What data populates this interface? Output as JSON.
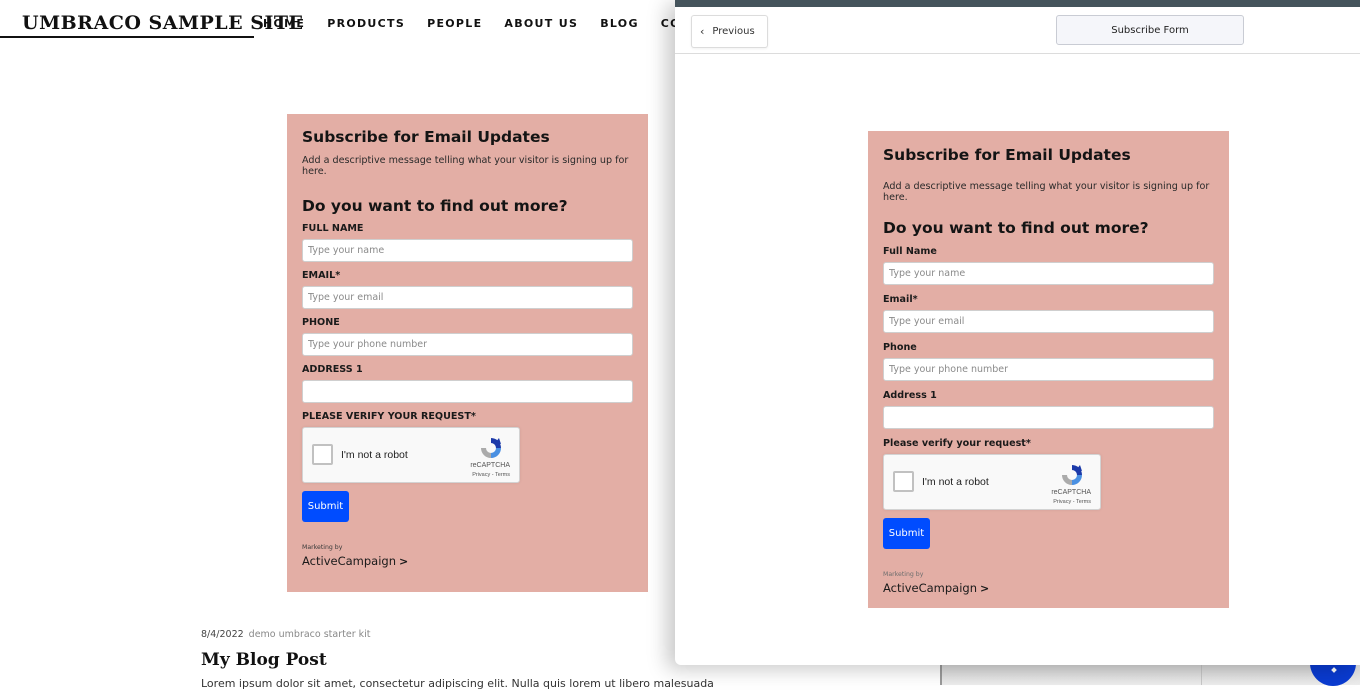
{
  "site": {
    "logo": "UMBRACO SAMPLE SITE",
    "nav": [
      "HOME",
      "PRODUCTS",
      "PEOPLE",
      "ABOUT US",
      "BLOG",
      "CONTACT"
    ],
    "blog": {
      "date": "8/4/2022",
      "tag": "demo umbraco starter kit",
      "title": "My Blog Post",
      "excerpt": "Lorem ipsum dolor sit amet, consectetur adipiscing elit. Nulla quis lorem ut libero malesuada"
    }
  },
  "form_live": {
    "title": "Subscribe for Email Updates",
    "description": "Add a descriptive message telling what your visitor is signing up for here.",
    "heading": "Do you want to find out more?",
    "fields": [
      {
        "label": "FULL NAME",
        "placeholder": "Type your name",
        "value": ""
      },
      {
        "label": "EMAIL*",
        "placeholder": "Type your email",
        "value": ""
      },
      {
        "label": "PHONE",
        "placeholder": "Type your phone number",
        "value": ""
      },
      {
        "label": "ADDRESS 1",
        "placeholder": "",
        "value": ""
      }
    ],
    "verify_label": "PLEASE VERIFY YOUR REQUEST*",
    "captcha": {
      "text": "I'm not a robot",
      "brand": "reCAPTCHA",
      "links": "Privacy - Terms",
      "checked": false
    },
    "submit": "Submit",
    "marketing_by": "Marketing by",
    "brand": "ActiveCampaign",
    "brand_chevron": ">"
  },
  "panel": {
    "previous": "Previous",
    "previous_icon": "‹",
    "form_selector": "Subscribe Form",
    "form_preview": {
      "title": "Subscribe for Email Updates",
      "description": "Add a descriptive message telling what your visitor is signing up for here.",
      "heading": "Do you want to find out more?",
      "fields": [
        {
          "label": "Full Name",
          "placeholder": "Type your name",
          "value": ""
        },
        {
          "label": "Email*",
          "placeholder": "Type your email",
          "value": ""
        },
        {
          "label": "Phone",
          "placeholder": "Type your phone number",
          "value": ""
        },
        {
          "label": "Address 1",
          "placeholder": "",
          "value": ""
        }
      ],
      "verify_label": "Please verify your request*",
      "captcha": {
        "text": "I'm not a robot",
        "brand": "reCAPTCHA",
        "links": "Privacy - Terms",
        "checked": false
      },
      "submit": "Submit",
      "marketing_by": "Marketing by",
      "brand": "ActiveCampaign",
      "brand_chevron": ">"
    }
  },
  "colors": {
    "form_bg": "#e3aea5",
    "submit_bg": "#004cff",
    "panel_topbar": "#45545c",
    "chat_bubble": "#0a3bd1"
  }
}
